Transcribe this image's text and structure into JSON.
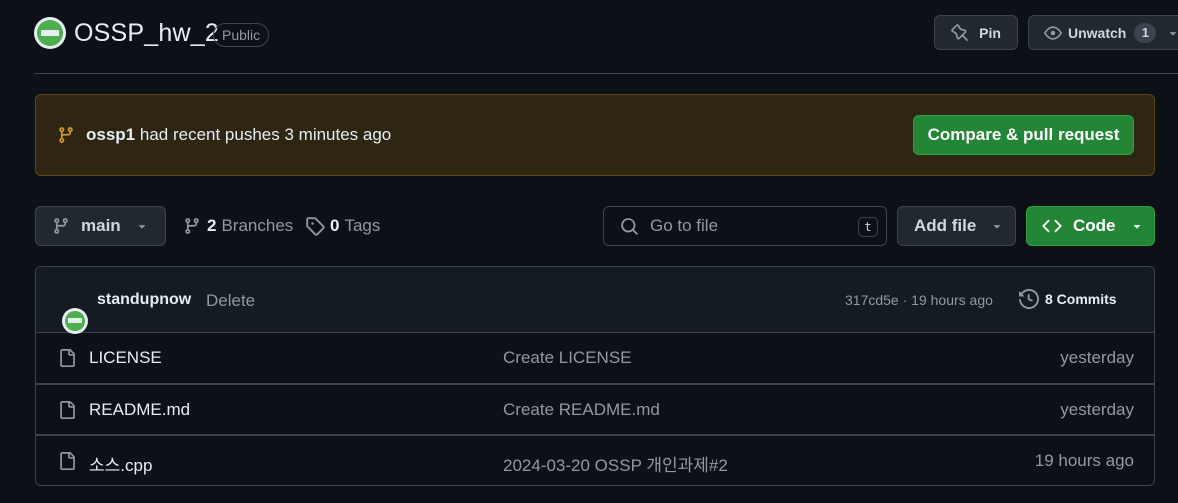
{
  "repo": {
    "name": "OSSP_hw_2",
    "visibility": "Public"
  },
  "header_actions": {
    "pin_label": "Pin",
    "unwatch_label": "Unwatch",
    "watch_count": "1"
  },
  "banner": {
    "user": "ossp1",
    "message": "had recent pushes 3 minutes ago",
    "compare_label": "Compare & pull request"
  },
  "toolbar": {
    "branch": "main",
    "branches_count": "2",
    "branches_label": "Branches",
    "tags_count": "0",
    "tags_label": "Tags",
    "search_placeholder": "Go to file",
    "search_shortcut": "t",
    "add_file_label": "Add file",
    "code_label": "Code"
  },
  "latest_commit": {
    "author": "standupnow",
    "message": "Delete",
    "hash_time": "317cd5e · 19 hours ago",
    "commits_label": "8 Commits"
  },
  "files": [
    {
      "name": "LICENSE",
      "message": "Create LICENSE",
      "date": "yesterday"
    },
    {
      "name": "README.md",
      "message": "Create README.md",
      "date": "yesterday"
    },
    {
      "name": "소스.cpp",
      "message": "2024-03-20 OSSP 개인과제#2",
      "date": "19 hours ago"
    }
  ],
  "colors": {
    "background": "#0d1117",
    "accent_green": "#238636",
    "banner_bg": "#2e2513",
    "border": "#3d444d"
  }
}
